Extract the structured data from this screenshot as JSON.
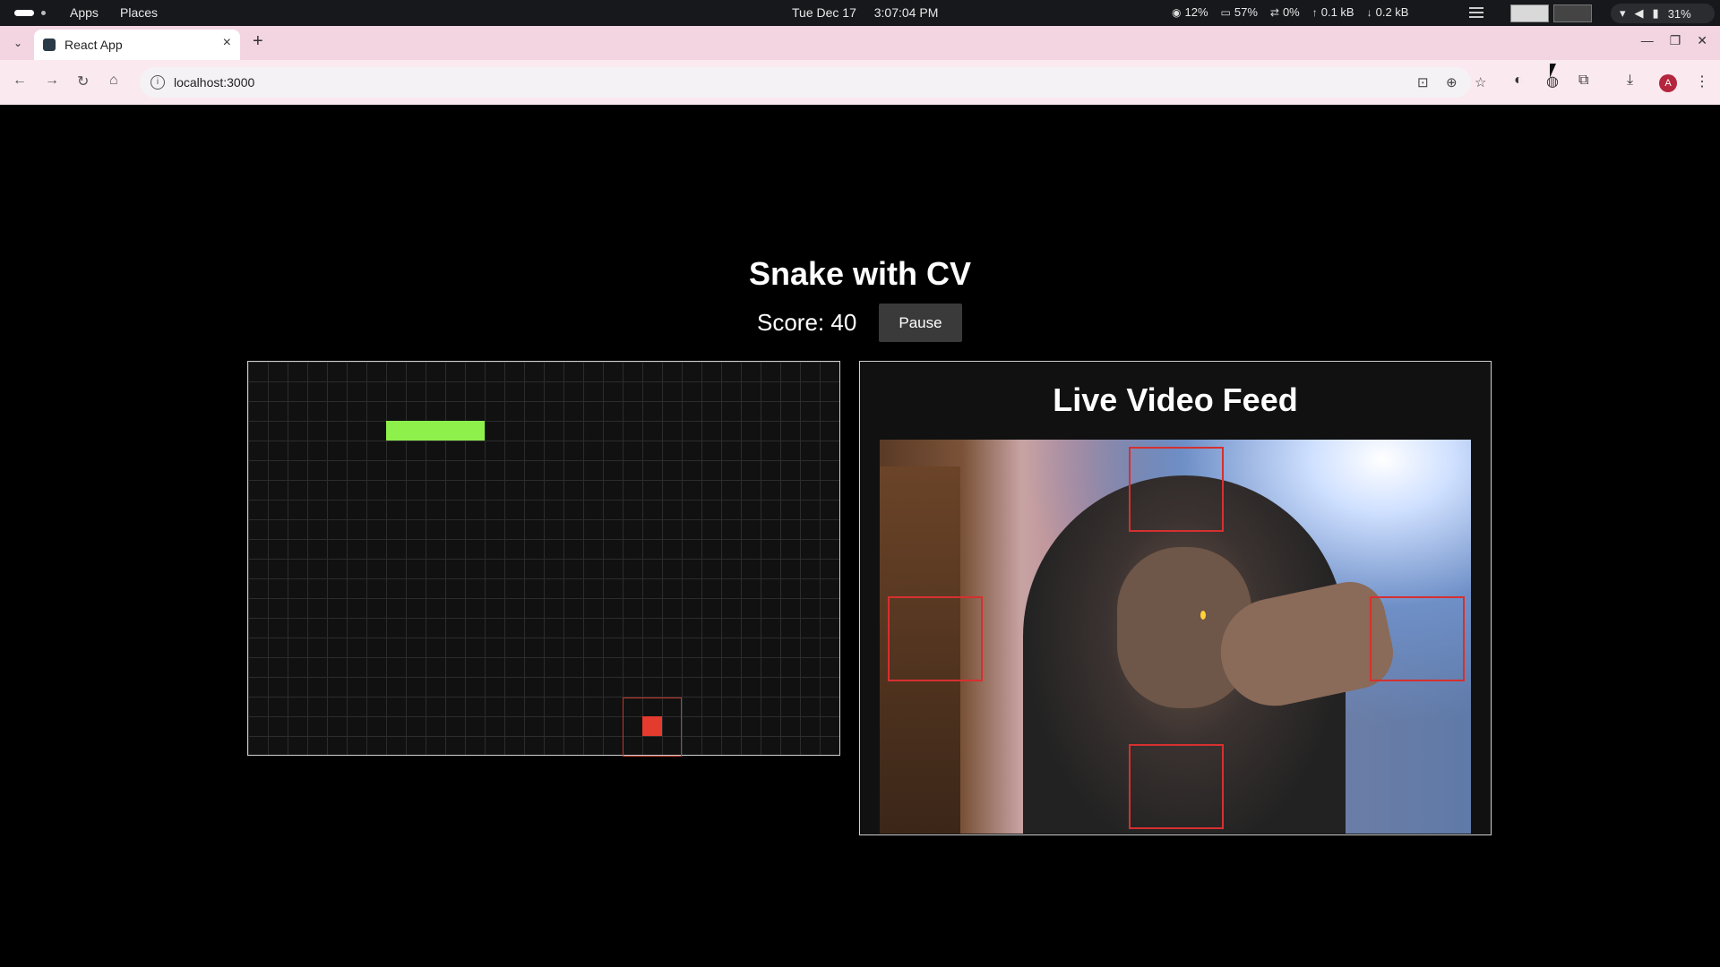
{
  "system_bar": {
    "apps_label": "Apps",
    "places_label": "Places",
    "date": "Tue Dec 17",
    "time": "3:07:04 PM",
    "cpu": "12%",
    "memory": "57%",
    "swap": "0%",
    "upload": "0.1 kB",
    "download": "0.2 kB",
    "battery": "31%"
  },
  "browser": {
    "tab_title": "React App",
    "new_tab_label": "+",
    "close_tab_label": "×",
    "url": "localhost:3000",
    "profile_initial": "A"
  },
  "game": {
    "title": "Snake with CV",
    "score_label": "Score: 40",
    "score": 40,
    "pause_label": "Pause",
    "colors": {
      "snake": "#8ef04a",
      "food": "#e33b2e",
      "zone": "#c0392b"
    }
  },
  "video": {
    "title": "Live Video Feed",
    "region_color": "#d63030"
  }
}
